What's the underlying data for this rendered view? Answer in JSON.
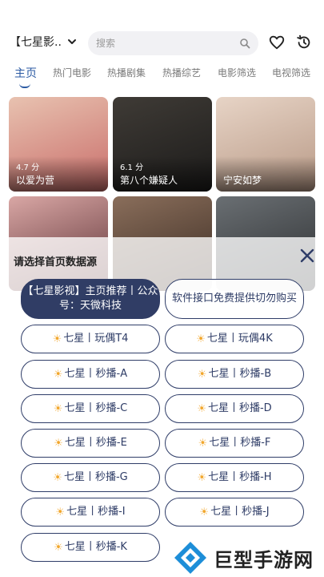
{
  "header": {
    "source_label": "【七星影..",
    "search_placeholder": "搜索",
    "icons": [
      "chevron-down-icon",
      "search-icon",
      "heart-icon",
      "history-icon"
    ]
  },
  "tabs": [
    {
      "label": "主页",
      "active": true
    },
    {
      "label": "热门电影",
      "active": false
    },
    {
      "label": "热播剧集",
      "active": false
    },
    {
      "label": "热播综艺",
      "active": false
    },
    {
      "label": "电影筛选",
      "active": false
    },
    {
      "label": "电视筛选",
      "active": false
    }
  ],
  "posters": [
    {
      "score": "4.7 分",
      "title": "以爱为营",
      "color_a": "#e8c2b0",
      "color_b": "#c96d6a"
    },
    {
      "score": "6.1 分",
      "title": "第八个嫌疑人",
      "color_a": "#3f3b36",
      "color_b": "#1c1b1a"
    },
    {
      "score": "",
      "title": "宁安如梦",
      "color_a": "#e7d4c6",
      "color_b": "#b89986"
    },
    {
      "score": "",
      "title": "",
      "color_a": "#d9a7a5",
      "color_b": "#5a2f33"
    },
    {
      "score": "",
      "title": "",
      "color_a": "#8a6e5b",
      "color_b": "#3a2b22"
    },
    {
      "score": "",
      "title": "",
      "color_a": "#6a6f73",
      "color_b": "#2c2e30"
    }
  ],
  "dialog": {
    "title": "请选择首页数据源",
    "options": [
      {
        "label": "【七星影视】主页推荐丨公众号：天微科技",
        "star": false,
        "primary": true
      },
      {
        "label": "软件接口免费提供切勿购买",
        "star": false,
        "primary": false
      },
      {
        "label": "七星丨玩偶T4",
        "star": true,
        "primary": false
      },
      {
        "label": "七星丨玩偶4K",
        "star": true,
        "primary": false
      },
      {
        "label": "七星丨秒播-A",
        "star": true,
        "primary": false
      },
      {
        "label": "七星丨秒播-B",
        "star": true,
        "primary": false
      },
      {
        "label": "七星丨秒播-C",
        "star": true,
        "primary": false
      },
      {
        "label": "七星丨秒播-D",
        "star": true,
        "primary": false
      },
      {
        "label": "七星丨秒播-E",
        "star": true,
        "primary": false
      },
      {
        "label": "七星丨秒播-F",
        "star": true,
        "primary": false
      },
      {
        "label": "七星丨秒播-G",
        "star": true,
        "primary": false
      },
      {
        "label": "七星丨秒播-H",
        "star": true,
        "primary": false
      },
      {
        "label": "七星丨秒播-I",
        "star": true,
        "primary": false
      },
      {
        "label": "七星丨秒播-J",
        "star": true,
        "primary": false
      },
      {
        "label": "七星丨秒播-K",
        "star": true,
        "primary": false
      }
    ]
  },
  "watermark": {
    "text": "巨型手游网",
    "accent": "#1d8ed8"
  },
  "colors": {
    "accent": "#2b5aa3",
    "button_dark": "#303d65",
    "star": "#f2a72c"
  }
}
